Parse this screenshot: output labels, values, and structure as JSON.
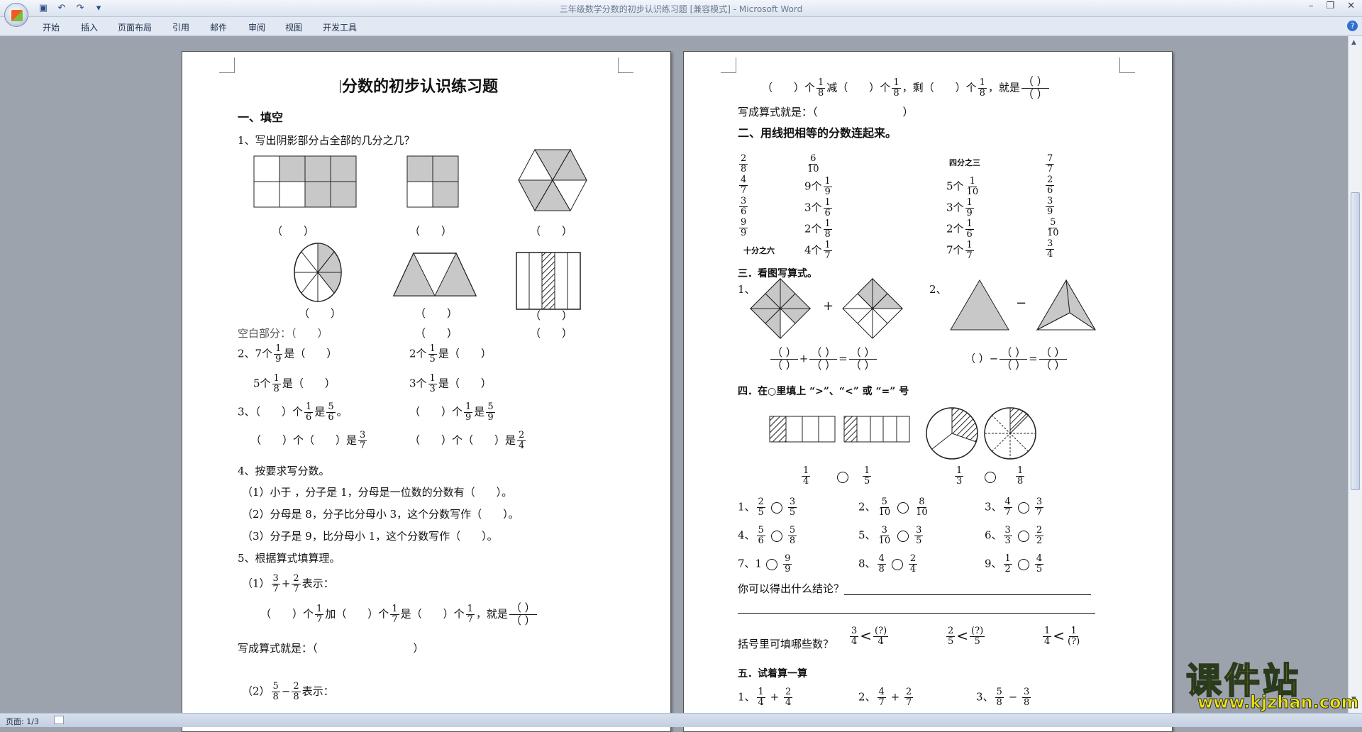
{
  "window": {
    "title": "三年级数学分数的初步认识练习题 [兼容模式] - Microsoft Word"
  },
  "ribbon": {
    "tabs": [
      "开始",
      "插入",
      "页面布局",
      "引用",
      "邮件",
      "审阅",
      "视图",
      "开发工具"
    ]
  },
  "status": {
    "page": "页面: 1/3"
  },
  "page1": {
    "title": "分数的初步认识练习题",
    "s1": "一、填空",
    "q1": "1、写出阴影部分占全部的几分之几？",
    "blank": "（　　）",
    "blank_space": "空白部分：（　　）",
    "q2a": "2、7个",
    "q2a_n": "1",
    "q2a_d": "9",
    "q2a_end": "是（　　）",
    "q2b": "2个",
    "q2b_n": "1",
    "q2b_d": "5",
    "q2b_end": "是（　　）",
    "q2c": "5个",
    "q2c_n": "1",
    "q2c_d": "8",
    "q2c_end": "是（　　）",
    "q2d": "3个",
    "q2d_n": "1",
    "q2d_d": "3",
    "q2d_end": "是（　　）",
    "q3a": "3、（　　）个",
    "q3a_n1": "1",
    "q3a_d1": "6",
    "q3a_mid": "是",
    "q3a_n2": "5",
    "q3a_d2": "6",
    "q3a_end": "。",
    "q3b": "（　　）个",
    "q3b_n1": "1",
    "q3b_d1": "9",
    "q3b_mid": "是",
    "q3b_n2": "5",
    "q3b_d2": "9",
    "q3c": "（　　）个（　　）是",
    "q3c_n": "3",
    "q3c_d": "7",
    "q3d": "（　　）个（　　）是",
    "q3d_n": "2",
    "q3d_d": "4",
    "q4": "4、按要求写分数。",
    "q4_1": "（1）小于 ，分子是 1，分母是一位数的分数有（　　）。",
    "q4_2": "（2）分母是 8，分子比分母小 3，这个分数写作（　　）。",
    "q4_3": "（3）分子是 9，比分母小 1，这个分数写作（　　）。",
    "q5": "5、根据算式填算理。",
    "q5_1_pre": "（1）",
    "q5_1_n1": "3",
    "q5_1_d1": "7",
    "q5_1_op": "+",
    "q5_1_n2": "2",
    "q5_1_d2": "7",
    "q5_1_end": "表示：",
    "q5_1b_pre": "（　　）个",
    "q5_1b_n1": "1",
    "q5_1b_d1": "7",
    "q5_1b_mid": "加（　　）个",
    "q5_1b_n2": "1",
    "q5_1b_d2": "7",
    "q5_1b_mid2": "是（　　）个",
    "q5_1b_n3": "1",
    "q5_1b_d3": "7",
    "q5_1b_end": "，就是",
    "paren": "（ ）",
    "q5_1c": "写成算式就是：（　　　　　　　　　）",
    "q5_2_pre": "（2）",
    "q5_2_n1": "5",
    "q5_2_d1": "8",
    "q5_2_op": "−",
    "q5_2_n2": "2",
    "q5_2_d2": "8",
    "q5_2_end": "表示："
  },
  "page2": {
    "l1_pre": "（　　）个",
    "l1_n1": "1",
    "l1_d1": "8",
    "l1_mid": "减（　　）个",
    "l1_n2": "1",
    "l1_d2": "8",
    "l1_mid2": "，剩（　　）个",
    "l1_n3": "1",
    "l1_d3": "8",
    "l1_end": "，就是",
    "l2": "写成算式就是：（　　　　　　　　）",
    "s2": "二、用线把相等的分数连起来。",
    "colA": [
      [
        "2",
        "8"
      ],
      [
        "4",
        "7"
      ],
      [
        "3",
        "6"
      ],
      [
        "9",
        "9"
      ]
    ],
    "colA_last": "十分之六",
    "colB_top": [
      "6",
      "10"
    ],
    "colB": [
      [
        "9个",
        "1",
        "9"
      ],
      [
        "3个",
        "1",
        "6"
      ],
      [
        "2个",
        "1",
        "8"
      ],
      [
        "4个",
        "1",
        "7"
      ]
    ],
    "colC_top": "四分之三",
    "colC": [
      [
        "5个",
        "1",
        "10"
      ],
      [
        "3个",
        "1",
        "9"
      ],
      [
        "2个",
        "1",
        "6"
      ],
      [
        "7个",
        "1",
        "7"
      ]
    ],
    "colD": [
      [
        "7",
        "7"
      ],
      [
        "2",
        "6"
      ],
      [
        "3",
        "9"
      ],
      [
        "5",
        "10"
      ],
      [
        "3",
        "4"
      ]
    ],
    "s3": "三．看图写算式。",
    "s3_1": "1、",
    "s3_2": "2、",
    "plus": "+",
    "minus": "−",
    "eq": "=",
    "s4": "四．在○里填上 “>”、“<” 或 “=” 号",
    "cmp_fig": [
      [
        "1",
        "4"
      ],
      [
        "1",
        "5"
      ],
      [
        "1",
        "3"
      ],
      [
        "1",
        "8"
      ]
    ],
    "cmp": [
      {
        "label": "1、",
        "a": [
          "2",
          "5"
        ],
        "b": [
          "3",
          "5"
        ]
      },
      {
        "label": "2、",
        "a": [
          "5",
          "10"
        ],
        "b": [
          "8",
          "10"
        ]
      },
      {
        "label": "3、",
        "a": [
          "4",
          "7"
        ],
        "b": [
          "3",
          "7"
        ]
      },
      {
        "label": "4、",
        "a": [
          "5",
          "6"
        ],
        "b": [
          "5",
          "8"
        ]
      },
      {
        "label": "5、",
        "a": [
          "3",
          "10"
        ],
        "b": [
          "3",
          "5"
        ]
      },
      {
        "label": "6、",
        "a": [
          "3",
          "3"
        ],
        "b": [
          "2",
          "2"
        ]
      },
      {
        "label": "7、1",
        "a": null,
        "b": [
          "9",
          "9"
        ]
      },
      {
        "label": "8、",
        "a": [
          "4",
          "8"
        ],
        "b": [
          "2",
          "4"
        ]
      },
      {
        "label": "9、",
        "a": [
          "1",
          "2"
        ],
        "b": [
          "4",
          "5"
        ]
      }
    ],
    "conclusion": "你可以得出什么结论？",
    "fill": "括号里可填哪些数？",
    "ineq": [
      {
        "a": [
          "3",
          "4"
        ],
        "op": "<",
        "b": [
          "(?)",
          "4"
        ]
      },
      {
        "a": [
          "2",
          "5"
        ],
        "op": "<",
        "b": [
          "(?)",
          "5"
        ]
      },
      {
        "a": [
          "1",
          "4"
        ],
        "op": "<",
        "b": [
          "1",
          "(?)"
        ]
      }
    ],
    "s5": "五．试着算一算",
    "calc": [
      {
        "label": "1、",
        "a": [
          "1",
          "4"
        ],
        "op": "+",
        "b": [
          "2",
          "4"
        ]
      },
      {
        "label": "2、",
        "a": [
          "4",
          "7"
        ],
        "op": "+",
        "b": [
          "2",
          "7"
        ]
      },
      {
        "label": "3、",
        "a": [
          "5",
          "8"
        ],
        "op": "−",
        "b": [
          "3",
          "8"
        ]
      }
    ]
  },
  "watermark": {
    "text": "课件站",
    "url": "www.kjzhan.com"
  }
}
